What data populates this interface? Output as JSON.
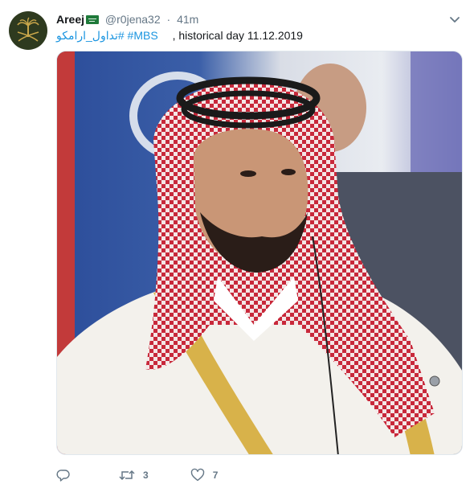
{
  "tweet": {
    "display_name": "Areej",
    "handle": "@r0jena32",
    "separator": "·",
    "time": "41m",
    "text": {
      "hashtag_arabic": "#تداول_ارامكو",
      "hashtag_mbs": "#MBS",
      "body": ", historical day 11.12.2019"
    },
    "media": {
      "description_colors": {
        "headdress": "#c8283a",
        "robe": "#f3f1ec",
        "gold_trim": "#d8b24a",
        "background_blue": "#3b5fa8"
      }
    },
    "actions": {
      "reply_count": "",
      "retweet_count": "3",
      "like_count": "7"
    }
  },
  "icons": {
    "avatar": "palm-and-swords-emblem-icon",
    "flag": "saudi-flag-icon",
    "caret": "chevron-down-icon",
    "reply": "reply-icon",
    "retweet": "retweet-icon",
    "like": "heart-icon"
  },
  "colors": {
    "link": "#1b95e0",
    "secondary_text": "#657786",
    "primary_text": "#14171a"
  }
}
